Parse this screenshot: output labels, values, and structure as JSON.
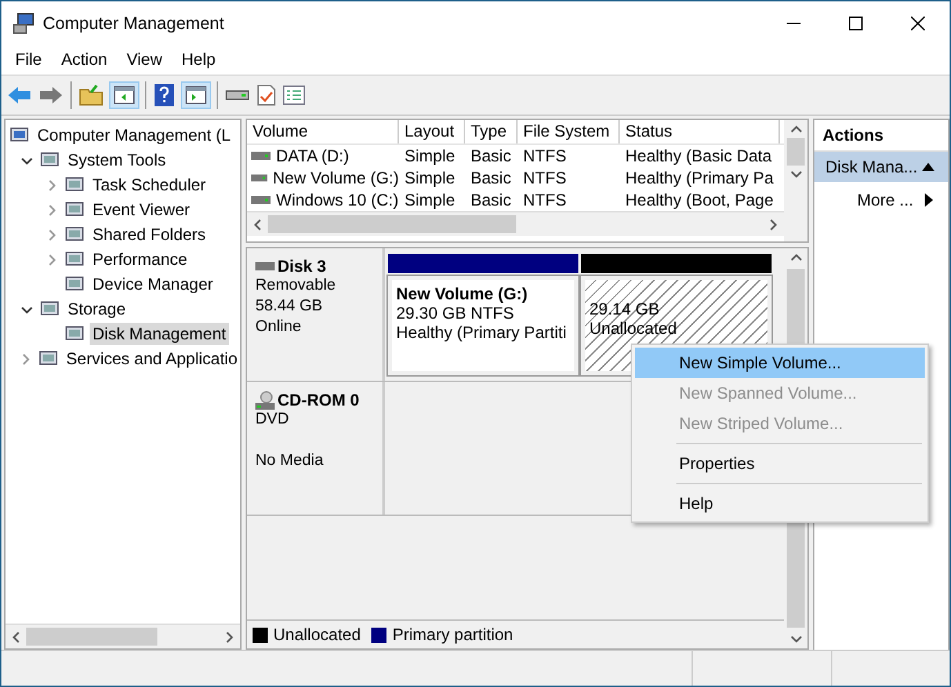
{
  "window": {
    "title": "Computer Management"
  },
  "menu": [
    "File",
    "Action",
    "View",
    "Help"
  ],
  "tree": [
    {
      "label": "Computer Management (L",
      "selected": false,
      "children": [
        {
          "label": "System Tools",
          "expanded": true,
          "selected": false,
          "children": [
            {
              "label": "Task Scheduler",
              "expanded": false,
              "selected": false
            },
            {
              "label": "Event Viewer",
              "expanded": false,
              "selected": false
            },
            {
              "label": "Shared Folders",
              "expanded": false,
              "selected": false
            },
            {
              "label": "Performance",
              "expanded": false,
              "selected": false
            },
            {
              "label": "Device Manager",
              "selected": false
            }
          ]
        },
        {
          "label": "Storage",
          "expanded": true,
          "selected": false,
          "children": [
            {
              "label": "Disk Management",
              "selected": true
            }
          ]
        },
        {
          "label": "Services and Applicatio",
          "expanded": false,
          "selected": false
        }
      ]
    }
  ],
  "volumes": {
    "columns": [
      "Volume",
      "Layout",
      "Type",
      "File System",
      "Status"
    ],
    "rows": [
      [
        "DATA (D:)",
        "Simple",
        "Basic",
        "NTFS",
        "Healthy (Basic Data"
      ],
      [
        "New Volume (G:)",
        "Simple",
        "Basic",
        "NTFS",
        "Healthy (Primary Pa"
      ],
      [
        "Windows 10 (C:)",
        "Simple",
        "Basic",
        "NTFS",
        "Healthy (Boot, Page"
      ]
    ]
  },
  "disks": [
    {
      "kind": "disk",
      "name": "Disk 3",
      "lines": [
        "Removable",
        "58.44 GB",
        "Online"
      ],
      "partitions": [
        {
          "kind": "primary",
          "color": "#000080",
          "name": "New Volume  (G:)",
          "lines": [
            "29.30 GB NTFS",
            "Healthy (Primary Partiti"
          ]
        },
        {
          "kind": "unallocated",
          "color": "#000000",
          "lines": [
            "29.14 GB",
            "Unallocated"
          ]
        }
      ]
    },
    {
      "kind": "cdrom",
      "name": "CD-ROM 0",
      "lines": [
        "DVD",
        "No Media"
      ]
    }
  ],
  "legend": [
    {
      "label": "Unallocated",
      "color": "#000000"
    },
    {
      "label": "Primary partition",
      "color": "#000080"
    }
  ],
  "context_menu": [
    [
      {
        "label": "New Simple Volume...",
        "disabled": false,
        "selected": true
      },
      {
        "label": "New Spanned Volume...",
        "disabled": true,
        "selected": false
      },
      {
        "label": "New Striped Volume...",
        "disabled": true,
        "selected": false
      }
    ],
    [
      {
        "label": "Properties",
        "disabled": false,
        "selected": false
      }
    ],
    [
      {
        "label": "Help",
        "disabled": false,
        "selected": false
      }
    ]
  ],
  "actions": {
    "title": "Actions",
    "section": "Disk Mana...",
    "items": [
      "More ..."
    ]
  }
}
